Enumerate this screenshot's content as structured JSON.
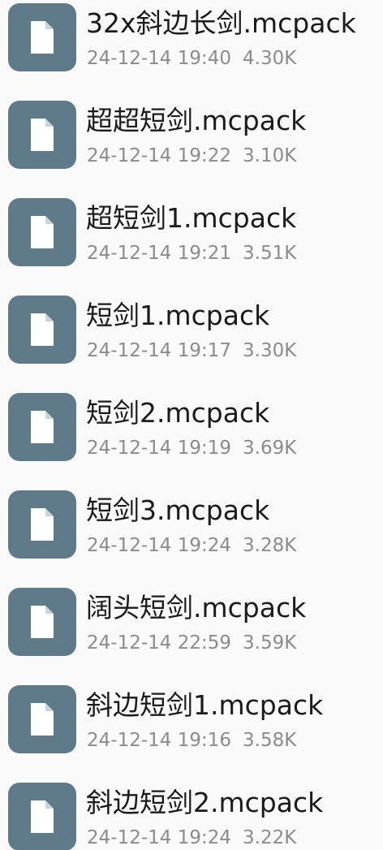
{
  "files": [
    {
      "name": "32x斜边长剑.mcpack",
      "date": "24-12-14 19:40",
      "size": "4.30K",
      "icon": "file-icon"
    },
    {
      "name": "超超短剑.mcpack",
      "date": "24-12-14 19:22",
      "size": "3.10K",
      "icon": "file-icon"
    },
    {
      "name": "超短剑1.mcpack",
      "date": "24-12-14 19:21",
      "size": "3.51K",
      "icon": "file-icon"
    },
    {
      "name": "短剑1.mcpack",
      "date": "24-12-14 19:17",
      "size": "3.30K",
      "icon": "file-icon"
    },
    {
      "name": "短剑2.mcpack",
      "date": "24-12-14 19:19",
      "size": "3.69K",
      "icon": "file-icon"
    },
    {
      "name": "短剑3.mcpack",
      "date": "24-12-14 19:24",
      "size": "3.28K",
      "icon": "file-icon"
    },
    {
      "name": "阔头短剑.mcpack",
      "date": "24-12-14 22:59",
      "size": "3.59K",
      "icon": "file-icon"
    },
    {
      "name": "斜边短剑1.mcpack",
      "date": "24-12-14 19:16",
      "size": "3.58K",
      "icon": "file-icon"
    },
    {
      "name": "斜边短剑2.mcpack",
      "date": "24-12-14 19:24",
      "size": "3.22K",
      "icon": "file-icon"
    }
  ],
  "colors": {
    "icon_background": "#5f7a89",
    "file_name": "#1b1b1b",
    "meta_text": "#8c8c8c",
    "background": "#fafafa"
  }
}
